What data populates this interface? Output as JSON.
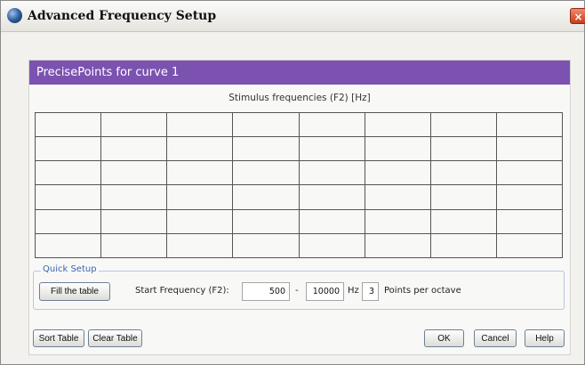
{
  "window": {
    "title": "Advanced Frequency Setup",
    "close_glyph": "×"
  },
  "panel": {
    "header": "PrecisePoints for curve 1",
    "subtitle": "Stimulus frequencies (F2) [Hz]"
  },
  "table": {
    "rows": 6,
    "cols": 8
  },
  "quick_setup": {
    "legend": "Quick Setup",
    "fill_button": "Fill the table",
    "start_label": "Start Frequency (F2):",
    "start_value": "500",
    "dash": "-",
    "end_value": "10000",
    "unit": "Hz",
    "points_value": "3",
    "points_label": "Points per octave"
  },
  "footer": {
    "sort_button": "Sort Table",
    "clear_button": "Clear Table",
    "ok_button": "OK",
    "cancel_button": "Cancel",
    "help_button": "Help"
  },
  "colors": {
    "header_bg": "#7b52b0",
    "dialog_bg": "#f2f1ed",
    "legend_text": "#3a64b0"
  }
}
